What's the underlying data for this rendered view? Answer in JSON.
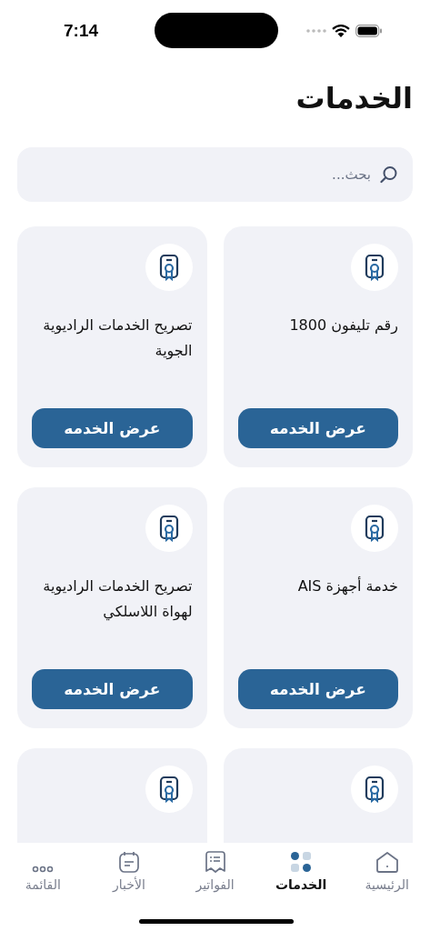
{
  "status_bar": {
    "time": "7:14"
  },
  "title": "الخدمات",
  "search": {
    "placeholder": "بحث..."
  },
  "services": [
    {
      "kind": "full",
      "title": "رقم تليفون 1800",
      "button": "عرض الخدمه"
    },
    {
      "kind": "full",
      "title": "تصريح الخدمات الراديوية الجوية",
      "button": "عرض الخدمه"
    },
    {
      "kind": "full",
      "title": "خدمة أجهزة AIS",
      "button": "عرض الخدمه"
    },
    {
      "kind": "full",
      "title": "تصريح الخدمات الراديوية لهواة اللاسلكي",
      "button": "عرض الخدمه"
    },
    {
      "kind": "cut_off"
    },
    {
      "kind": "cut_off"
    }
  ],
  "tab_bar": [
    {
      "kind": "home",
      "label": "الرئيسية",
      "selected": false
    },
    {
      "kind": "services",
      "label": "الخدمات",
      "selected": true
    },
    {
      "kind": "bills",
      "label": "الفواتير",
      "selected": false
    },
    {
      "kind": "news",
      "label": "الأخبار",
      "selected": false
    },
    {
      "kind": "menu",
      "label": "القائمة",
      "selected": false
    }
  ]
}
